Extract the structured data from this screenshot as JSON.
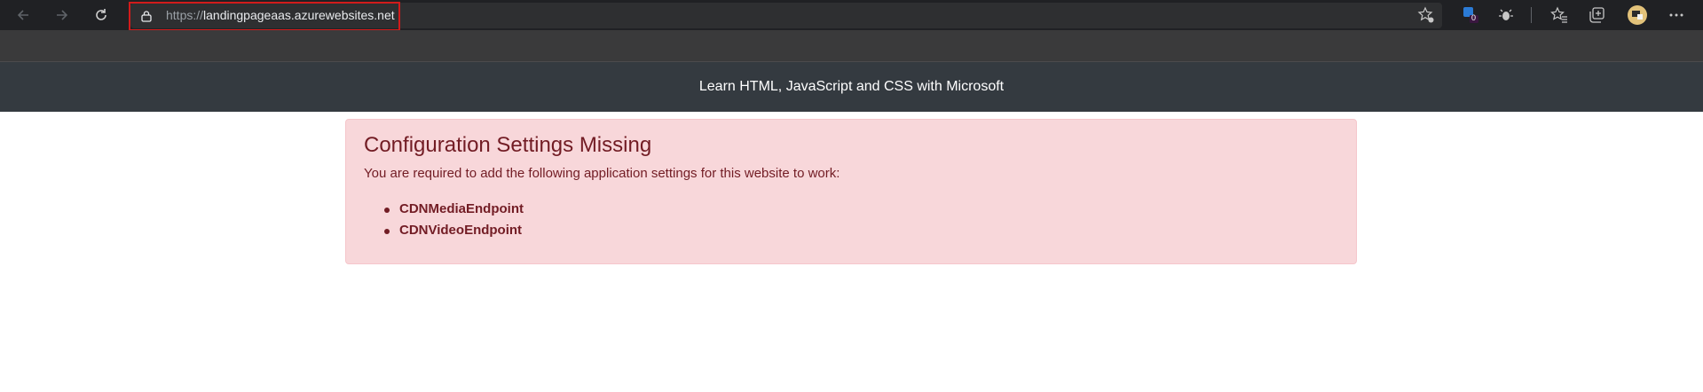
{
  "browser": {
    "address_bar": {
      "scheme": "https://",
      "host": "landingpageaas.azurewebsites.net"
    },
    "extension_badge": "0",
    "toolbar_icons": [
      "back-icon",
      "forward-icon",
      "refresh-icon",
      "lock-icon",
      "favorite-add-icon",
      "extension-icon",
      "bug-icon",
      "favorites-icon",
      "collections-icon",
      "profile-avatar",
      "more-icon"
    ]
  },
  "page": {
    "header_title": "Learn HTML, JavaScript and CSS with Microsoft",
    "alert": {
      "title": "Configuration Settings Missing",
      "message": "You are required to add the following application settings for this website to work:",
      "items": [
        "CDNMediaEndpoint",
        "CDNVideoEndpoint"
      ]
    }
  },
  "colors": {
    "chrome_bg": "#202124",
    "header_bg": "#343a40",
    "alert_bg": "#f8d7da",
    "alert_text": "#721c24",
    "highlight": "#d21b1b"
  }
}
